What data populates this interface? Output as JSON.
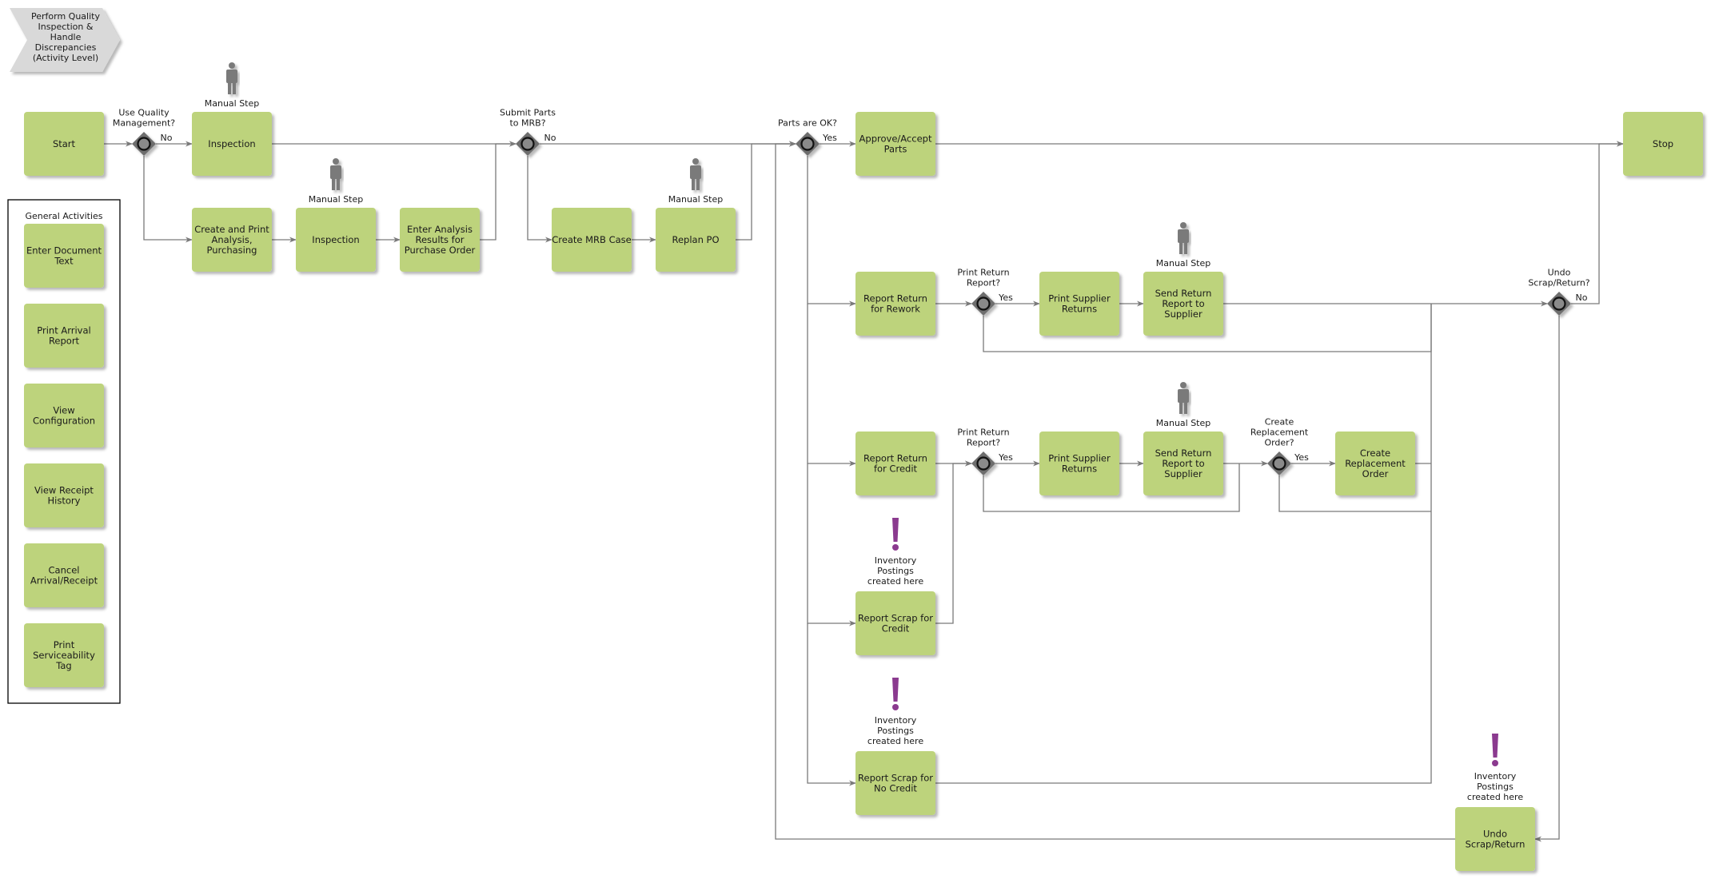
{
  "title": "Perform Quality Inspection & Handle Discrepancies (Activity Level)",
  "colors": {
    "task_fill": "#bdd37c",
    "title_fill": "#d9d9d9",
    "gateway_fill": "#6e6e6e",
    "edge": "#7a7a7a",
    "manual_icon": "#7a7a7a",
    "posting_icon": "#8b3a8f"
  },
  "panel": {
    "heading": "General Activities",
    "items": [
      {
        "id": "ga1",
        "label": "Enter Document Text"
      },
      {
        "id": "ga2",
        "label": "Print Arrival Report"
      },
      {
        "id": "ga3",
        "label": "View Configuration"
      },
      {
        "id": "ga4",
        "label": "View Receipt History"
      },
      {
        "id": "ga5",
        "label": "Cancel Arrival/Receipt"
      },
      {
        "id": "ga6",
        "label": "Print Serviceability Tag"
      }
    ]
  },
  "tasks": [
    {
      "id": "start",
      "label": "Start"
    },
    {
      "id": "insp1",
      "label": "Inspection",
      "manual": true
    },
    {
      "id": "createPrint",
      "label": "Create and Print Analysis, Purchasing"
    },
    {
      "id": "insp2",
      "label": "Inspection",
      "manual": true
    },
    {
      "id": "enterResults",
      "label": "Enter Analysis Results for Purchase Order"
    },
    {
      "id": "createMrb",
      "label": "Create MRB Case"
    },
    {
      "id": "replan",
      "label": "Replan PO",
      "manual": true
    },
    {
      "id": "approve",
      "label": "Approve/Accept Parts"
    },
    {
      "id": "stop",
      "label": "Stop"
    },
    {
      "id": "rework",
      "label": "Report Return for Rework"
    },
    {
      "id": "printSup1",
      "label": "Print Supplier Returns"
    },
    {
      "id": "sendRet1",
      "label": "Send Return Report to Supplier",
      "manual": true
    },
    {
      "id": "credit",
      "label": "Report Return for Credit"
    },
    {
      "id": "printSup2",
      "label": "Print Supplier Returns"
    },
    {
      "id": "sendRet2",
      "label": "Send Return Report to Supplier",
      "manual": true
    },
    {
      "id": "createRepl",
      "label": "Create Replacement Order"
    },
    {
      "id": "scrapCredit",
      "label": "Report Scrap for Credit",
      "posting": true
    },
    {
      "id": "scrapNoCredit",
      "label": "Report Scrap for No Credit",
      "posting": true
    },
    {
      "id": "undo",
      "label": "Undo Scrap/Return",
      "posting": true
    }
  ],
  "gateways": [
    {
      "id": "g1",
      "question": "Use Quality Management?",
      "branch_label": "No"
    },
    {
      "id": "g2",
      "question": "Submit Parts to MRB?",
      "branch_label": "No"
    },
    {
      "id": "g3",
      "question": "Parts are OK?",
      "branch_label": "Yes"
    },
    {
      "id": "g4",
      "question": "Print Return Report?",
      "branch_label": "Yes"
    },
    {
      "id": "g5",
      "question": "Print Return Report?",
      "branch_label": "Yes"
    },
    {
      "id": "g6",
      "question": "Create Replacement Order?",
      "branch_label": "Yes"
    },
    {
      "id": "g7",
      "question": "Undo Scrap/Return?",
      "branch_label": "No"
    }
  ],
  "annotations": {
    "manual_step": "Manual Step",
    "inventory_posting": "Inventory Postings created here"
  }
}
